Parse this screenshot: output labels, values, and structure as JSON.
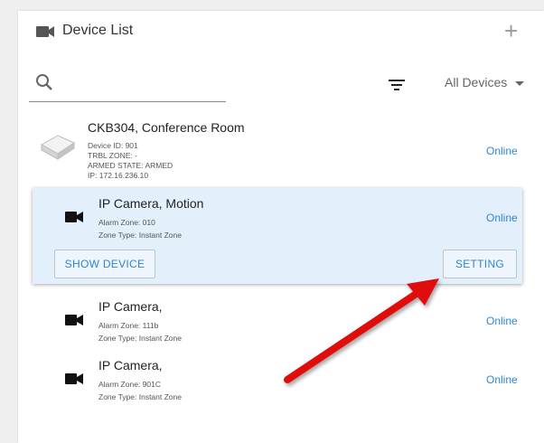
{
  "header": {
    "title": "Device List",
    "add_label": "+"
  },
  "toolbar": {
    "search_value": "",
    "filter_dropdown": "All Devices"
  },
  "devices": [
    {
      "name": "CKB304, Conference Room",
      "details": [
        "Device ID: 901",
        "TRBL ZONE: -",
        "ARMED STATE: ARMED",
        "IP: 172.16.236.10"
      ],
      "status": "Online"
    },
    {
      "name": "IP Camera, Motion",
      "details": [
        "Alarm Zone: 010",
        "Zone Type: Instant Zone"
      ],
      "status": "Online",
      "actions": {
        "show_device": "SHOW DEVICE",
        "setting": "SETTING"
      }
    },
    {
      "name": "IP Camera,",
      "details": [
        "Alarm Zone: 111b",
        "Zone Type: Instant Zone"
      ],
      "status": "Online"
    },
    {
      "name": "IP Camera,",
      "details": [
        "Alarm Zone: 901C",
        "Zone Type: Instant Zone"
      ],
      "status": "Online"
    }
  ],
  "colors": {
    "accent": "#2f86d1",
    "selected_bg": "#e3f0fc",
    "arrow": "#e01010"
  },
  "icons": [
    "video-camera-icon",
    "plus-icon",
    "search-icon",
    "filter-icon",
    "chevron-down-icon",
    "keypad-device-icon"
  ]
}
